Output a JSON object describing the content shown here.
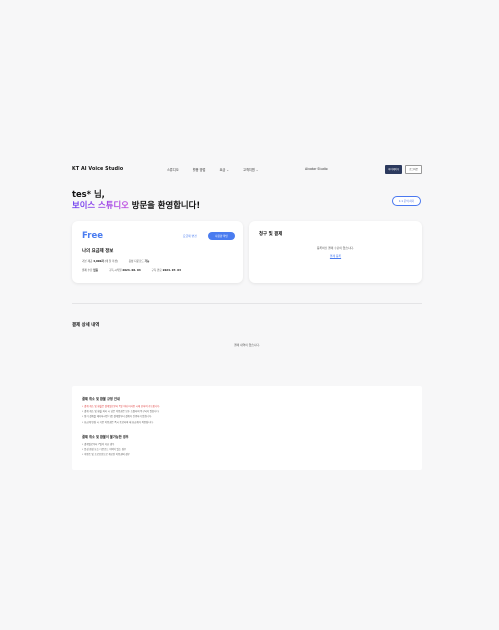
{
  "header": {
    "logo": "KT AI Voice Studio",
    "menu": [
      "스튜디오",
      "활용 방법",
      "요금 ⌄",
      "고객지원 ⌄"
    ],
    "aivatar": "Aivatar Studio",
    "mypage_label": "마이페이지",
    "logout_label": "로그아웃"
  },
  "welcome": {
    "line1": "tes* 님,",
    "line2_highlight": "보이스 스튜디오",
    "line2_rest": " 방문을 환영합니다!",
    "inquiry_label": "1:1 문의 하기"
  },
  "plan": {
    "name": "Free",
    "change_label": "요금제 변경",
    "button_label": "사용량 확인",
    "title": "나의 요금제 정보",
    "row1_label1": "기본 제공",
    "row1_value1": "4,000자",
    "row1_suffix": "(매 달 리셋)",
    "row1_label2": "음성 다운로드",
    "row1_value2": "가능",
    "row2_label1": "결제 수단",
    "row2_value1": "없음",
    "row2_label2": "구독 시작일",
    "row2_value2": "2024. 06. 04",
    "row2_label3": "구독 만료",
    "row2_value3": "2024. 07. 03"
  },
  "payment": {
    "title": "청구 및 결제",
    "empty": "등록하신 결제 수단이 없습니다.",
    "link": "결제 등록"
  },
  "details": {
    "title": "결제 상세 내역",
    "empty": "결제 내역이 없습니다."
  },
  "notice": {
    "section1": "결제 취소 및 환불 규정 안내",
    "items1": [
      "결제 취소 및 환불은 결제일로부터 7일 이내 미사용 시에 한하여 가능합니다.",
      "결제 취소 및 환불 처리 시 남은 이용권은 모두 소멸되며 복구되지 않습니다.",
      "정기 결제를 해지하시면 다음 결제일부터 결제가 진행되지 않습니다.",
      "요금제 변경 시 기존 이용권은 즉시 종료되며 새 요금제가 적용됩니다."
    ],
    "section2": "결제 취소 및 환불이 불가능한 경우",
    "items2": [
      "결제일로부터 7일이 지난 경우",
      "음성 합성 또는 다운로드 이력이 있는 경우",
      "이벤트 및 프로모션으로 제공된 이용권의 경우"
    ]
  }
}
